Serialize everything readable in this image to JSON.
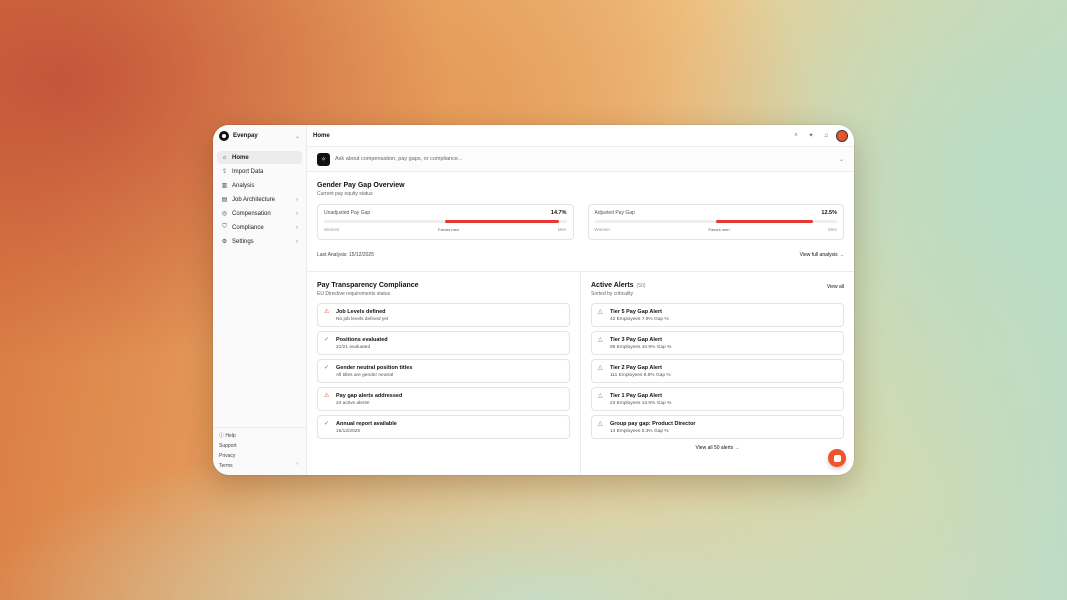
{
  "sidebar": {
    "org_name": "Evenpay",
    "items": [
      {
        "label": "Home",
        "icon": "home-icon",
        "active": true,
        "has_children": false
      },
      {
        "label": "Import Data",
        "icon": "upload-icon",
        "active": false,
        "has_children": false
      },
      {
        "label": "Analysis",
        "icon": "chart-icon",
        "active": false,
        "has_children": false
      },
      {
        "label": "Job Architecture",
        "icon": "briefcase-icon",
        "active": false,
        "has_children": true
      },
      {
        "label": "Compensation",
        "icon": "coin-icon",
        "active": false,
        "has_children": true
      },
      {
        "label": "Compliance",
        "icon": "shield-icon",
        "active": false,
        "has_children": true
      },
      {
        "label": "Settings",
        "icon": "gear-icon",
        "active": false,
        "has_children": true
      }
    ],
    "footer": {
      "help": "Help",
      "support": "Support",
      "privacy": "Privacy",
      "terms": "Terms"
    }
  },
  "header": {
    "title": "Home"
  },
  "ask": {
    "placeholder": "Ask about compensation, pay gaps, or compliance..."
  },
  "overview": {
    "title": "Gender Pay Gap Overview",
    "subtitle": "Current pay equity status",
    "unadjusted": {
      "label": "Unadjusted Pay Gap",
      "value": "14.7%",
      "left": "Women",
      "mid": "Favors men",
      "right": "Men",
      "fill_percent": 14.7
    },
    "adjusted": {
      "label": "Adjusted Pay Gap",
      "value": "12.5%",
      "left": "Women",
      "mid": "Favors men",
      "right": "Men",
      "fill_percent": 12.5
    },
    "last_analysis": "Last Analysis: 15/12/2025",
    "view_full": "View full analysis →"
  },
  "compliance": {
    "title": "Pay Transparency Compliance",
    "subtitle": "EU Directive requirements status",
    "items": [
      {
        "title": "Job Levels defined",
        "desc": "No job levels defined yet",
        "status": "warn"
      },
      {
        "title": "Positions evaluated",
        "desc": "21/21 evaluated",
        "status": "ok"
      },
      {
        "title": "Gender neutral position titles",
        "desc": "All titles are gender neutral",
        "status": "ok"
      },
      {
        "title": "Pay gap alerts addressed",
        "desc": "24 active alerts!",
        "status": "warn"
      },
      {
        "title": "Annual report available",
        "desc": "15/12/2025",
        "status": "ok"
      }
    ]
  },
  "alerts": {
    "title": "Active Alerts",
    "count": "(50)",
    "subtitle": "Sorted by criticality",
    "view_all": "View all",
    "items": [
      {
        "title": "Tier 5 Pay Gap Alert",
        "desc": "42 Employees  7.9% Gap %"
      },
      {
        "title": "Tier 3 Pay Gap Alert",
        "desc": "95 Employees  10.9% Gap %"
      },
      {
        "title": "Tier 2 Pay Gap Alert",
        "desc": "111 Employees  9.8% Gap %"
      },
      {
        "title": "Tier 1 Pay Gap Alert",
        "desc": "23 Employees  13.5% Gap %"
      },
      {
        "title": "Group pay gap: Product Director",
        "desc": "14 Employees  5.3% Gap %"
      }
    ],
    "view_all_footer": "View all 50 alerts →"
  }
}
